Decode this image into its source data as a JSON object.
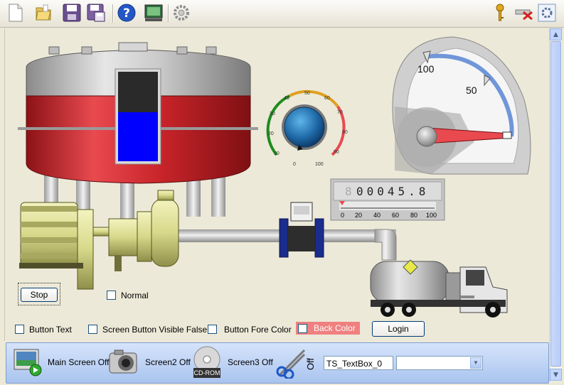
{
  "toolbar": {
    "icons": [
      "new-file-icon",
      "open-folder-icon",
      "save-icon",
      "save-as-icon",
      "help-icon",
      "hmi-icon",
      "settings-gear-icon",
      "key-icon",
      "disconnect-icon",
      "config-icon"
    ]
  },
  "process": {
    "flowmeter_display": "00045.8",
    "flowmeter_scale": [
      "0",
      "20",
      "40",
      "60",
      "80",
      "100"
    ],
    "flowmeter_level": 0.0,
    "knob_scale": [
      "0",
      "10",
      "20",
      "30",
      "40",
      "50",
      "60",
      "70",
      "80",
      "90",
      "100"
    ],
    "gauge_labels": [
      "100",
      "50"
    ],
    "tank_level": 0.55,
    "stop_label": "Stop",
    "normal_label": "Normal"
  },
  "options": {
    "button_text": "Button Text",
    "visible_false": "Screen Button Visible False",
    "fore_color": "Button Fore Color",
    "back_color": "Back Color",
    "login": "Login"
  },
  "bottom": {
    "main_screen": "Main Screen Off",
    "screen2": "Screen2 Off",
    "screen3": "Screen3 Off",
    "cdrom_caption": "CD-ROM",
    "off_vertical": "Off",
    "textbox_value": "TS_TextBox_0",
    "combo_value": ""
  },
  "colors": {
    "tank_red": "#c8242a",
    "tank_blue": "#0000ff",
    "back_color_fill": "#f08080",
    "machinery_yellow": "#d8d88a"
  }
}
